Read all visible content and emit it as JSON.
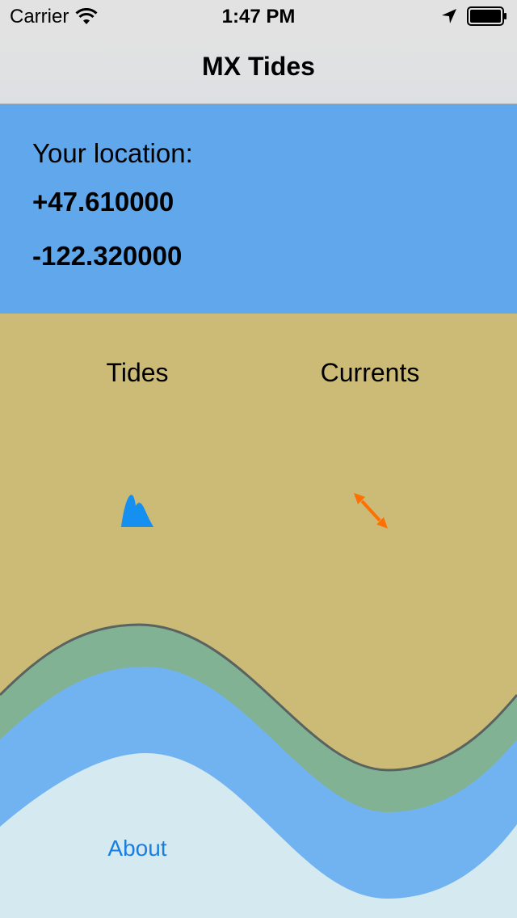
{
  "status_bar": {
    "carrier": "Carrier",
    "time": "1:47 PM",
    "icons": [
      "wifi-icon",
      "location-arrow-icon",
      "battery-icon"
    ]
  },
  "nav": {
    "title": "MX Tides"
  },
  "location": {
    "label": "Your location:",
    "latitude": "+47.610000",
    "longitude": "-122.320000"
  },
  "menu": {
    "tides_label": "Tides",
    "currents_label": "Currents",
    "tides_icon": "tide-wave-icon",
    "currents_icon": "current-arrows-icon",
    "about_label": "About"
  },
  "colors": {
    "location_panel": "#61a7eb",
    "sand": "#cbbb77",
    "green_band": "#82b294",
    "water": "#70b3f0",
    "foam": "#d4eaf0",
    "link": "#1a7ee0",
    "tides_icon": "#1590f0",
    "currents_icon": "#ff7000"
  }
}
